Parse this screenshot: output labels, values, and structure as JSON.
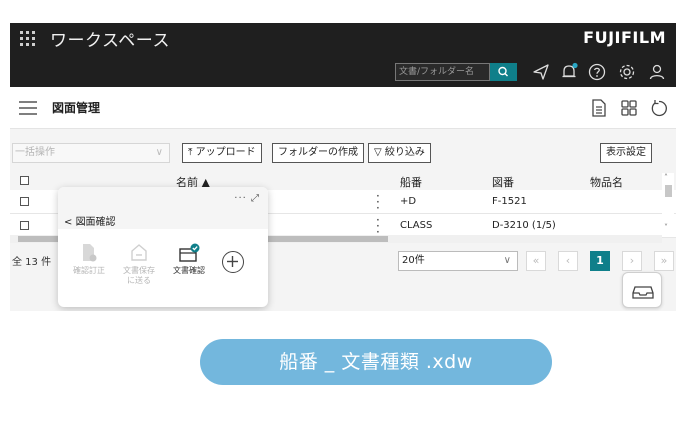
{
  "topbar": {
    "title": "ワークスペース",
    "brand": "FUJIFILM",
    "search_placeholder": "文書/フォルダー名",
    "icons": [
      "apps-grid-icon",
      "search-icon",
      "send-icon",
      "bell-icon",
      "help-icon",
      "gear-icon",
      "user-icon"
    ],
    "notification_dot_color": "#2aa7c4"
  },
  "subbar": {
    "title": "図面管理",
    "icons": [
      "hamburger-icon",
      "document-icon",
      "tiles-icon",
      "refresh-icon"
    ]
  },
  "toolbar": {
    "bulk_action_placeholder": "一括操作",
    "upload_label": "アップロード",
    "create_folder_label": "フォルダーの作成",
    "filter_label": "絞り込み",
    "display_settings_label": "表示設定"
  },
  "table": {
    "columns": [
      "名前 ▲",
      "船番",
      "図番",
      "物品名"
    ],
    "rows": [
      {
        "ship_no": "+D",
        "drawing_no": "F-1521",
        "item_name": ""
      },
      {
        "ship_no": "CLASS",
        "drawing_no": "D-3210 (1/5)",
        "item_name": ""
      }
    ]
  },
  "footer": {
    "total": "全 13 件",
    "page_size": "20件",
    "current_page": "1"
  },
  "panel": {
    "tab_label": "図面確認",
    "controls": "··· ⤢",
    "tools": [
      {
        "label": "確認訂正",
        "enabled": false
      },
      {
        "label": "文書保存\nに送る",
        "enabled": false
      },
      {
        "label": "文書確認",
        "enabled": true
      }
    ],
    "check_color": "#0f7f8a"
  },
  "caption": "船番 _ 文書種類 .xdw",
  "colors": {
    "accent": "#0f7f8a",
    "header_bg": "#1f1f1f",
    "caption_bg": "#73b7dd"
  }
}
